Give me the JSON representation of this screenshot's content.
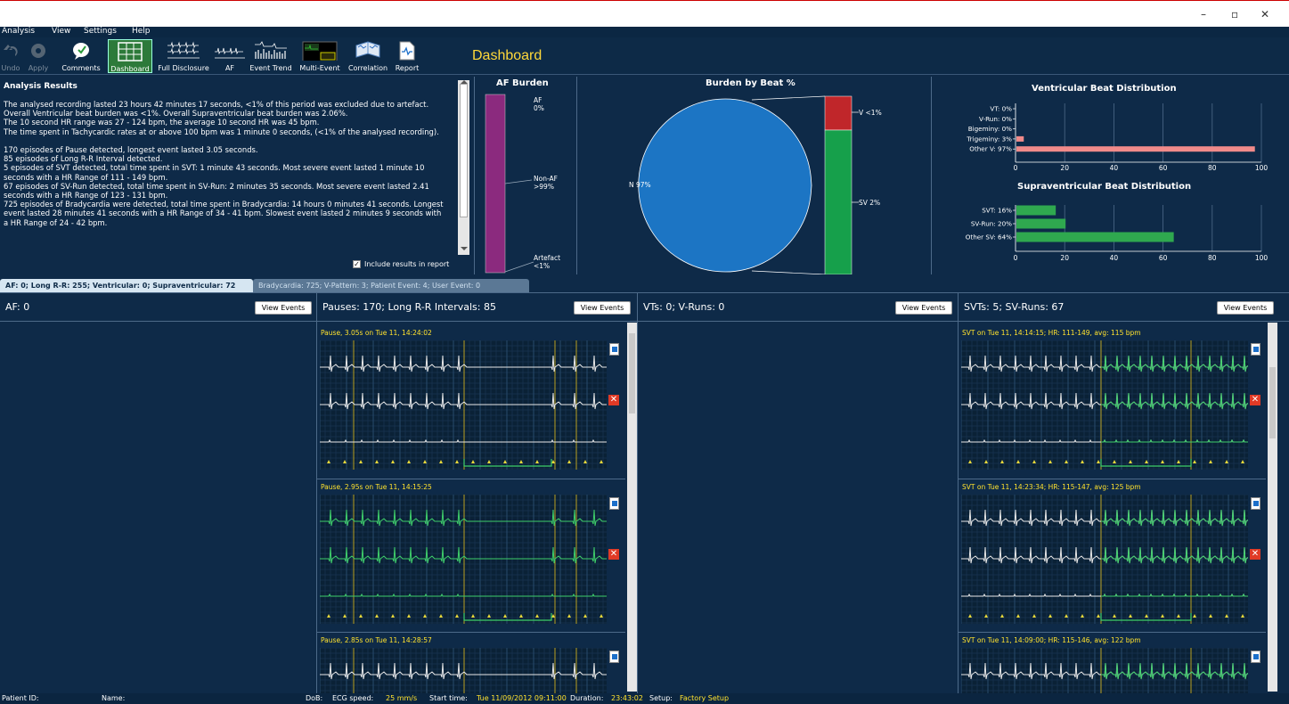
{
  "window": {
    "minimize": "–",
    "restore": "▫",
    "close": "✕"
  },
  "menu": [
    "Analysis",
    "View",
    "Settings",
    "Help"
  ],
  "toolbar": {
    "items": [
      {
        "label": "Undo",
        "icon": "undo-icon"
      },
      {
        "label": "Apply",
        "icon": "gear-icon"
      },
      {
        "label": "Comments",
        "icon": "comments-icon"
      },
      {
        "label": "Dashboard",
        "icon": "dashboard-icon"
      },
      {
        "label": "Full Disclosure",
        "icon": "full-disclosure-icon"
      },
      {
        "label": "AF",
        "icon": "af-icon"
      },
      {
        "label": "Event Trend",
        "icon": "event-trend-icon"
      },
      {
        "label": "Multi-Event",
        "icon": "multi-event-icon"
      },
      {
        "label": "Correlation",
        "icon": "correlation-icon"
      },
      {
        "label": "Report",
        "icon": "report-icon"
      }
    ]
  },
  "page_title": "Dashboard",
  "analysis": {
    "heading": "Analysis Results",
    "text": "The analysed recording lasted 23 hours 42 minutes 17 seconds, <1% of this period was excluded due to artefact.\nOverall Ventricular beat burden was <1%. Overall Supraventricular beat burden was 2.06%.\nThe 10 second HR range was 27 - 124 bpm, the average 10 second HR was 45 bpm.\nThe time spent in Tachycardic rates at or above 100 bpm was 1 minute 0 seconds, (<1% of the analysed recording).\n\n170 episodes of Pause detected, longest event lasted 3.05 seconds.\n85 episodes of Long R-R Interval detected.\n5 episodes of SVT detected, total time spent in SVT: 1 minute 43 seconds. Most severe event lasted 1 minute 10 seconds with a HR Range of 111 - 149 bpm.\n67 episodes of SV-Run detected, total time spent in SV-Run: 2 minutes 35 seconds. Most severe event lasted 2.41 seconds with a HR Range of 123 - 131 bpm.\n725 episodes of Bradycardia were detected, total time spent in Bradycardia: 14 hours 0 minutes 41 seconds. Longest event lasted 28 minutes 41 seconds with a HR Range of 34 - 41 bpm. Slowest event lasted 2 minutes 9 seconds with a HR Range of 24 - 42 bpm.",
    "include_label": "Include results in report",
    "include_checked": true
  },
  "af_burden": {
    "title": "AF Burden",
    "labels": [
      {
        "name": "AF",
        "value": "0%"
      },
      {
        "name": "Non-AF",
        "value": ">99%"
      },
      {
        "name": "Artefact",
        "value": "<1%"
      }
    ],
    "colors": {
      "bar": "#8b2a7e"
    }
  },
  "burden_by_beat": {
    "title": "Burden by Beat %",
    "pie_label": "N 97%",
    "stack_labels": [
      "V <1%",
      "SV 2%"
    ],
    "colors": {
      "N": "#1c75c4",
      "V": "#c0262a",
      "SV": "#16a04b"
    }
  },
  "ventricular_dist": {
    "title": "Ventricular Beat Distribution",
    "axis_ticks": [
      "0",
      "20",
      "40",
      "60",
      "80",
      "100"
    ]
  },
  "sv_dist": {
    "title": "Supraventricular Beat Distribution",
    "axis_ticks": [
      "0",
      "20",
      "40",
      "60",
      "80",
      "100"
    ]
  },
  "chart_data": [
    {
      "type": "bar",
      "title": "AF Burden",
      "categories": [
        "AF",
        "Non-AF",
        "Artefact"
      ],
      "values": [
        0,
        99.5,
        0.5
      ],
      "stacked": true
    },
    {
      "type": "pie",
      "title": "Burden by Beat %",
      "categories": [
        "N",
        "SV",
        "V"
      ],
      "values": [
        97,
        2,
        1
      ]
    },
    {
      "type": "bar",
      "orientation": "horizontal",
      "title": "Ventricular Beat Distribution",
      "categories": [
        "VT",
        "V-Run",
        "Bigeminy",
        "Trigeminy",
        "Other V"
      ],
      "tick_labels": [
        "VT: 0%",
        "V-Run: 0%",
        "Bigeminy: 0%",
        "Trigeminy: 3%",
        "Other V: 97%"
      ],
      "values": [
        0,
        0,
        0,
        3,
        97
      ],
      "xlim": [
        0,
        100
      ],
      "grid": true,
      "color": "#f08a8a"
    },
    {
      "type": "bar",
      "orientation": "horizontal",
      "title": "Supraventricular Beat Distribution",
      "categories": [
        "SVT",
        "SV-Run",
        "Other SV"
      ],
      "tick_labels": [
        "SVT: 16%",
        "SV-Run: 20%",
        "Other SV: 64%"
      ],
      "values": [
        16,
        20,
        64
      ],
      "xlim": [
        0,
        100
      ],
      "grid": true,
      "color": "#2fa84f"
    }
  ],
  "tabs": [
    {
      "label": "AF: 0; Long R-R: 255; Ventricular: 0; Supraventricular: 72",
      "active": true
    },
    {
      "label": "Bradycardia: 725; V-Pattern: 3; Patient Event: 4; User Event: 0",
      "active": false
    }
  ],
  "panels": [
    {
      "title": "AF: 0",
      "button": "View Events",
      "events": []
    },
    {
      "title": "Pauses: 170; Long R-R Intervals: 85",
      "button": "View Events",
      "events": [
        "Pause, 3.05s on Tue 11, 14:24:02",
        "Pause, 2.95s on Tue 11, 14:15:25",
        "Pause, 2.85s on Tue 11, 14:28:57"
      ]
    },
    {
      "title": "VTs: 0; V-Runs: 0",
      "button": "View Events",
      "events": []
    },
    {
      "title": "SVTs: 5; SV-Runs: 67",
      "button": "View Events",
      "events": [
        "SVT on Tue 11, 14:14:15; HR: 111-149, avg: 115 bpm",
        "SVT on Tue 11, 14:23:34; HR: 115-147, avg: 125 bpm",
        "SVT on Tue 11, 14:09:00; HR: 115-146, avg: 122 bpm"
      ]
    }
  ],
  "status": {
    "patient_id_label": "Patient ID:",
    "name_label": "Name:",
    "dob_label": "DoB:",
    "ecg_speed_label": "ECG speed:",
    "ecg_speed": "25 mm/s",
    "start_label": "Start time:",
    "start": "Tue 11/09/2012 09:11:00",
    "duration_label": "Duration:",
    "duration": "23:43:02",
    "setup_label": "Setup:",
    "setup": "Factory Setup"
  }
}
